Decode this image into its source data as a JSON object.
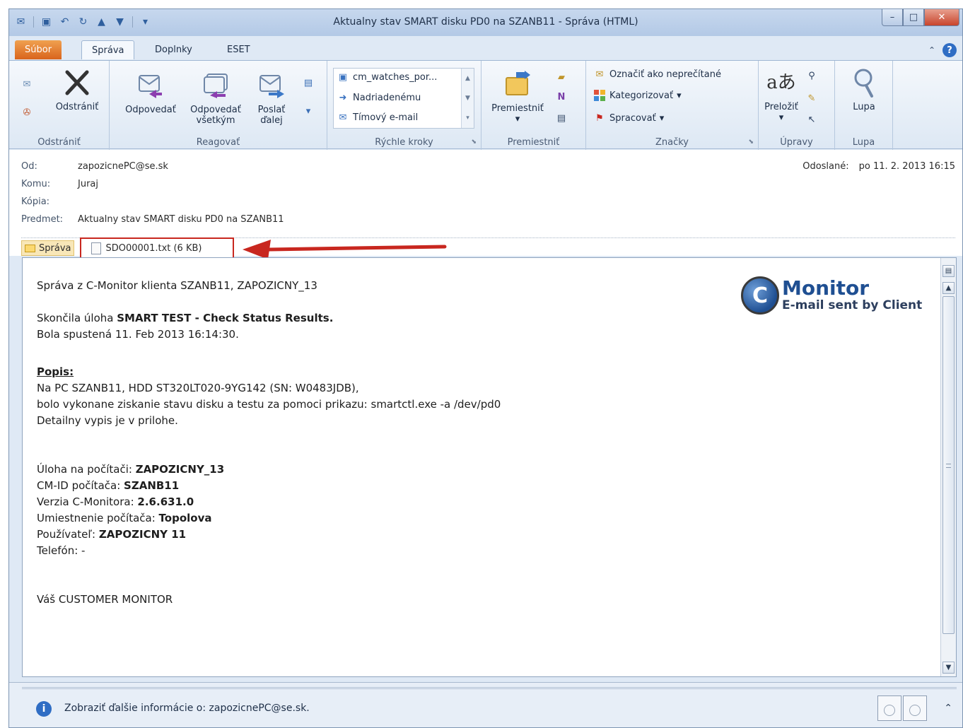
{
  "window": {
    "title": "Aktualny stav SMART disku PD0 na SZANB11 - Správa (HTML)",
    "controls": {
      "minimize": "–",
      "maximize": "□",
      "close": "✕"
    }
  },
  "qat": {
    "icons": [
      "mail-icon",
      "save-icon",
      "undo-icon",
      "redo-icon",
      "up-arrow-icon",
      "down-arrow-icon",
      "customize-icon"
    ]
  },
  "tabs": {
    "file": "Súbor",
    "message": "Správa",
    "addins": "Doplnky",
    "eset": "ESET"
  },
  "ribbon": {
    "delete_group": {
      "label": "Odstrániť",
      "delete_button": "Odstrániť"
    },
    "respond_group": {
      "label": "Reagovať",
      "reply": "Odpovedať",
      "reply_all_line1": "Odpovedať",
      "reply_all_line2": "všetkým",
      "forward_line1": "Poslať",
      "forward_line2": "ďalej"
    },
    "quick_steps_group": {
      "label": "Rýchle kroky",
      "items": [
        "cm_watches_por...",
        "Nadriadenému",
        "Tímový e-mail"
      ]
    },
    "move_group": {
      "label": "Premiestniť",
      "move_button": "Premiestniť"
    },
    "tags_group": {
      "label": "Značky",
      "mark_unread": "Označiť ako neprečítané",
      "categorize": "Kategorizovať",
      "follow_up": "Spracovať"
    },
    "editing_group": {
      "label": "Úpravy",
      "translate": "Preložiť"
    },
    "zoom_group": {
      "label": "Lupa",
      "zoom": "Lupa"
    }
  },
  "header": {
    "from_label": "Od:",
    "from_value": "zapozicnePC@se.sk",
    "to_label": "Komu:",
    "to_value": "Juraj",
    "cc_label": "Kópia:",
    "subject_label": "Predmet:",
    "subject_value": "Aktualny stav SMART disku PD0 na SZANB11",
    "sent_label": "Odoslané:",
    "sent_value": "po 11. 2. 2013 16:15"
  },
  "attachments": {
    "message_tab": "Správa",
    "file": "SDO00001.txt (6 KB)"
  },
  "body": {
    "line1": "Správa z C-Monitor klienta SZANB11, ZAPOZICNY_13",
    "task_prefix": "Skončila úloha ",
    "task_name": "SMART TEST - Check Status Results",
    "task_suffix": ".",
    "started": "Bola spustená 11. Feb 2013 16:14:30.",
    "desc_heading": "Popis:",
    "desc_line1": "Na PC SZANB11, HDD ST320LT020-9YG142 (SN: W0483JDB),",
    "desc_line2": "bolo vykonane ziskanie stavu disku a testu za pomoci prikazu: smartctl.exe -a /dev/pd0",
    "desc_line3": "Detailny vypis je v prilohe.",
    "task_on_pc_label": "Úloha na počítači: ",
    "task_on_pc_value": "ZAPOZICNY_13",
    "cmid_label": "CM-ID počítača: ",
    "cmid_value": "SZANB11",
    "version_label": "Verzia C-Monitora: ",
    "version_value": "2.6.631.0",
    "location_label": "Umiestnenie počítača: ",
    "location_value": "Topolova",
    "user_label": "Používateľ: ",
    "user_value": "ZAPOZICNY 11",
    "phone": "Telefón: -",
    "signature": "Váš CUSTOMER MONITOR"
  },
  "logo": {
    "letter": "C",
    "name": "Monitor",
    "tagline": "E-mail sent by Client"
  },
  "people_pane": {
    "text": "Zobraziť ďalšie informácie o: zapozicnePC@se.sk."
  },
  "colors": {
    "file_tab": "#d9641c",
    "highlight_red": "#c8271f",
    "logo_blue": "#1f4f92"
  }
}
